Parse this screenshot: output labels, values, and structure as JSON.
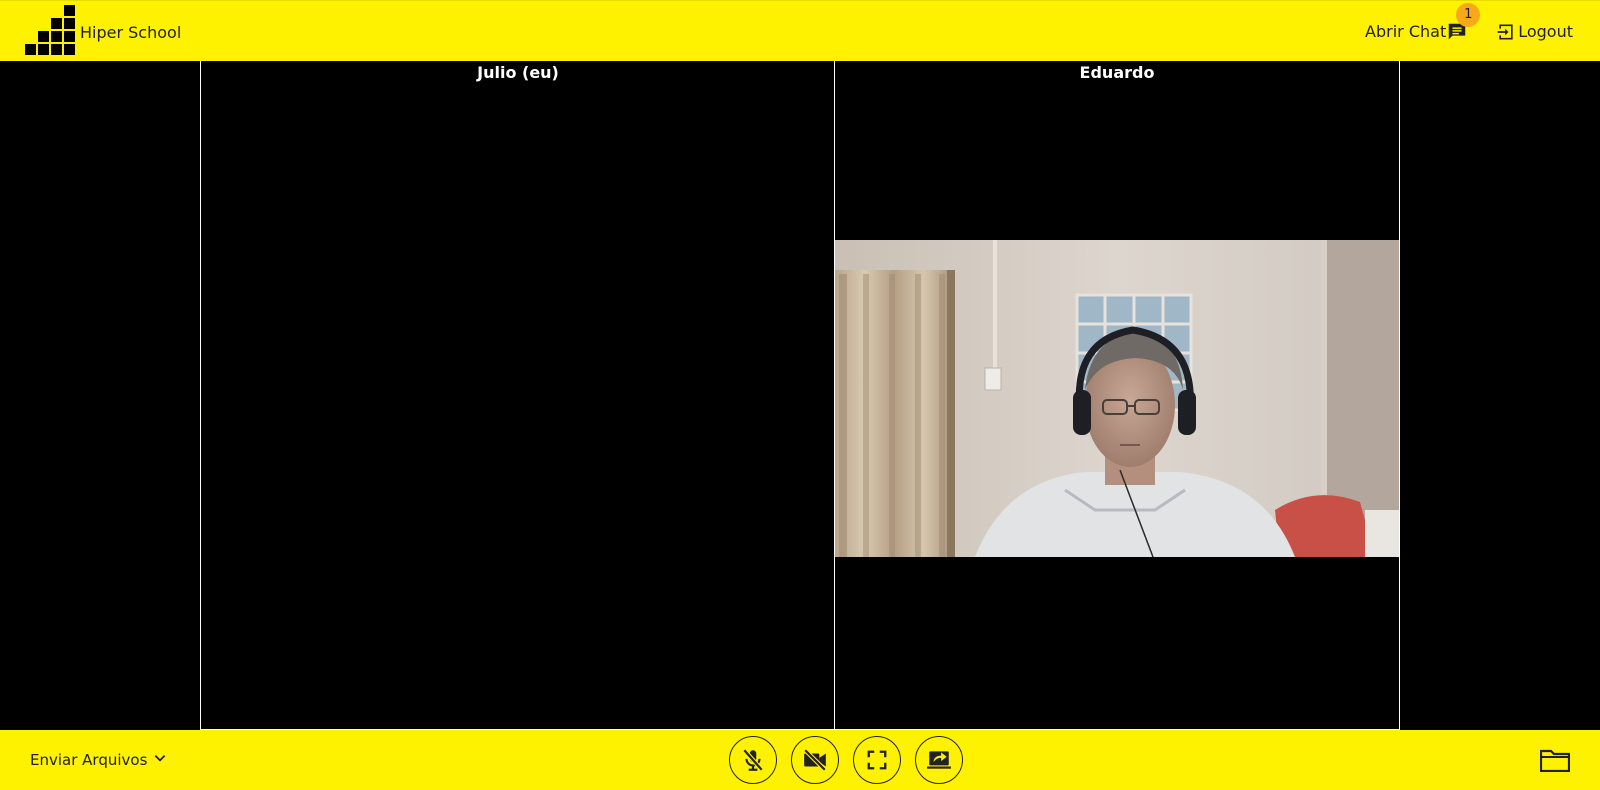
{
  "app": {
    "name": "Hiper School"
  },
  "header": {
    "chat_label": "Abrir Chat",
    "chat_badge": "1",
    "logout_label": "Logout"
  },
  "participants": [
    {
      "name": "Julio (eu)",
      "video": "off"
    },
    {
      "name": "Eduardo",
      "video": "on"
    }
  ],
  "footer": {
    "files_label": "Enviar Arquivos",
    "controls": [
      "mic-off-icon",
      "camera-off-icon",
      "fullscreen-icon",
      "share-screen-icon"
    ],
    "folder_icon": "folder-icon"
  },
  "colors": {
    "accent": "#fff200",
    "badge": "#f7a81b",
    "stage": "#000000"
  }
}
